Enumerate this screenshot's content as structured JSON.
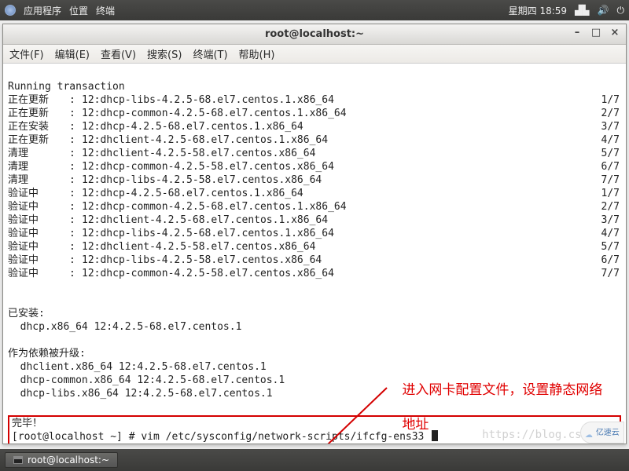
{
  "panel": {
    "applications": "应用程序",
    "places": "位置",
    "terminal": "终端",
    "clock": "星期四 18:59"
  },
  "window": {
    "title": "root@localhost:~",
    "min": "–",
    "max": "□",
    "close": "×",
    "menus": {
      "file": "文件(F)",
      "edit": "编辑(E)",
      "view": "查看(V)",
      "search": "搜索(S)",
      "terminal": "终端(T)",
      "help": "帮助(H)"
    }
  },
  "term": {
    "running": "Running transaction",
    "rows": [
      {
        "status": "正在更新",
        "col": ": 12:",
        "pkg": "dhcp-libs-4.2.5-68.el7.centos.1.x86_64",
        "prog": "1/7"
      },
      {
        "status": "正在更新",
        "col": ": 12:",
        "pkg": "dhcp-common-4.2.5-68.el7.centos.1.x86_64",
        "prog": "2/7"
      },
      {
        "status": "正在安装",
        "col": ": 12:",
        "pkg": "dhcp-4.2.5-68.el7.centos.1.x86_64",
        "prog": "3/7"
      },
      {
        "status": "正在更新",
        "col": ": 12:",
        "pkg": "dhclient-4.2.5-68.el7.centos.1.x86_64",
        "prog": "4/7"
      },
      {
        "status": "清理",
        "col": ": 12:",
        "pkg": "dhclient-4.2.5-58.el7.centos.x86_64",
        "prog": "5/7"
      },
      {
        "status": "清理",
        "col": ": 12:",
        "pkg": "dhcp-common-4.2.5-58.el7.centos.x86_64",
        "prog": "6/7"
      },
      {
        "status": "清理",
        "col": ": 12:",
        "pkg": "dhcp-libs-4.2.5-58.el7.centos.x86_64",
        "prog": "7/7"
      },
      {
        "status": "验证中",
        "col": ": 12:",
        "pkg": "dhcp-4.2.5-68.el7.centos.1.x86_64",
        "prog": "1/7"
      },
      {
        "status": "验证中",
        "col": ": 12:",
        "pkg": "dhcp-common-4.2.5-68.el7.centos.1.x86_64",
        "prog": "2/7"
      },
      {
        "status": "验证中",
        "col": ": 12:",
        "pkg": "dhclient-4.2.5-68.el7.centos.1.x86_64",
        "prog": "3/7"
      },
      {
        "status": "验证中",
        "col": ": 12:",
        "pkg": "dhcp-libs-4.2.5-68.el7.centos.1.x86_64",
        "prog": "4/7"
      },
      {
        "status": "验证中",
        "col": ": 12:",
        "pkg": "dhclient-4.2.5-58.el7.centos.x86_64",
        "prog": "5/7"
      },
      {
        "status": "验证中",
        "col": ": 12:",
        "pkg": "dhcp-libs-4.2.5-58.el7.centos.x86_64",
        "prog": "6/7"
      },
      {
        "status": "验证中",
        "col": ": 12:",
        "pkg": "dhcp-common-4.2.5-58.el7.centos.x86_64",
        "prog": "7/7"
      }
    ],
    "installed_header": "已安装:",
    "installed_line": "  dhcp.x86_64 12:4.2.5-68.el7.centos.1",
    "depupg_header": "作为依赖被升级:",
    "dep_lines": [
      "  dhclient.x86_64 12:4.2.5-68.el7.centos.1",
      "  dhcp-common.x86_64 12:4.2.5-68.el7.centos.1",
      "  dhcp-libs.x86_64 12:4.2.5-68.el7.centos.1"
    ],
    "done": "完毕！",
    "prompt": "[root@localhost ~] # vim /etc/sysconfig/network-scripts/ifcfg-ens33 "
  },
  "annotation": {
    "line1": "进入网卡配置文件，设置静态网络",
    "line2": "地址"
  },
  "taskbar": {
    "item": "root@localhost:~"
  },
  "watermark": "https://blog.csd",
  "badge": "亿速云"
}
